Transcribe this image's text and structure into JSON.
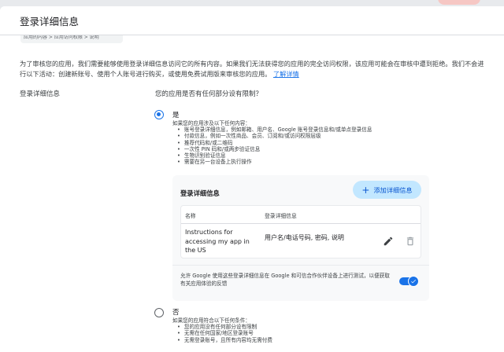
{
  "dialog": {
    "title": "登录详细信息",
    "breadcrumb": "应用的内容 > 应用访问权限 > 说明"
  },
  "intro": {
    "text": "为了审核您的应用，我们需要能够使用登录详细信息访问它的所有内容。如果我们无法获得您的应用的完全访问权限，该应用可能会在审核中遭到拒绝。我们不会进行以下活动：创建新账号、使用个人账号进行购买，或使用免费试用版来审核您的应用。",
    "link": "了解详情"
  },
  "section": {
    "left_label": "登录详细信息",
    "question": "您的应用是否有任何部分设有限制？"
  },
  "option_yes": {
    "label": "是",
    "selected": true,
    "desc_title": "如果您的应用涉及以下任何内容：",
    "items": [
      "账号登录详细信息，例如邮箱、用户名、Google 账号登录信息和/或单点登录信息",
      "付款信息，例如一次性商品、会员、订阅和/或访问权限层级",
      "推荐代码和/或二维码",
      "一次性 PIN 码和/或两步验证信息",
      "生物识别验证信息",
      "需要在另一台设备上执行操作"
    ]
  },
  "card": {
    "title": "登录详细信息",
    "add_button": "添加详细信息",
    "columns": [
      "名称",
      "登录详细信息"
    ],
    "row": {
      "name": "Instructions for accessing my app in the US",
      "info": "用户名/电话号码, 密码, 说明"
    },
    "consent": "允许 Google 使用这些登录详细信息在 Google 和可信合作伙伴设备上进行测试，以便获取有关应用体验的反馈",
    "consent_enabled": true
  },
  "option_no": {
    "label": "否",
    "selected": false,
    "desc_title": "如果您的应用符合以下任何条件：",
    "items": [
      "您的应用没有任何部分设有限制",
      "无需在任何国家/地区登录账号",
      "无需登录账号，且所有内容均无需付费"
    ]
  },
  "colors": {
    "accent": "#1a73e8",
    "button_bg": "#c2e7ff",
    "button_text": "#0b57d0"
  }
}
